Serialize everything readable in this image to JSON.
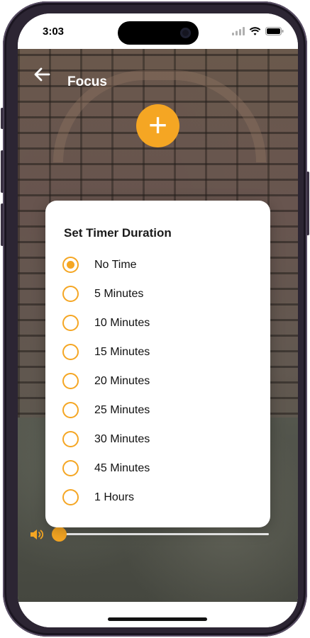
{
  "status_bar": {
    "time": "3:03",
    "icons": [
      "cellular-icon",
      "wifi-icon",
      "battery-icon"
    ]
  },
  "header": {
    "back_icon": "arrow-left-icon",
    "title": "Focus"
  },
  "add_button": {
    "icon": "plus-icon",
    "label": "+"
  },
  "dialog": {
    "title": "Set Timer Duration",
    "selected_index": 0,
    "options": [
      {
        "label": "No Time"
      },
      {
        "label": "5 Minutes"
      },
      {
        "label": "10 Minutes"
      },
      {
        "label": "15 Minutes"
      },
      {
        "label": "20 Minutes"
      },
      {
        "label": "25 Minutes"
      },
      {
        "label": "30 Minutes"
      },
      {
        "label": "45 Minutes"
      },
      {
        "label": "1 Hours"
      }
    ]
  },
  "volume": {
    "icon": "speaker-icon",
    "level": 0.0
  },
  "colors": {
    "accent": "#f5a623",
    "dialog_bg": "#ffffff",
    "text": "#111111"
  }
}
